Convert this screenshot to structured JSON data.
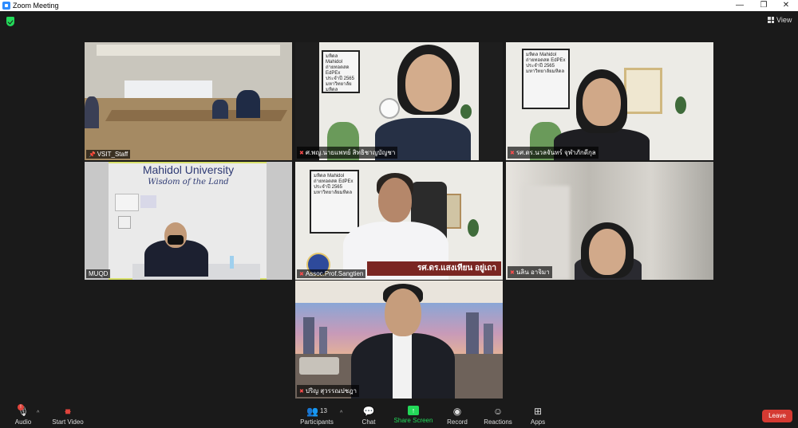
{
  "window": {
    "title": "Zoom Meeting",
    "controls": {
      "minimize": "—",
      "maximize": "❐",
      "close": "✕"
    }
  },
  "top": {
    "view_label": "View"
  },
  "participants": [
    {
      "name": "VSIT_Staff",
      "pinned": true
    },
    {
      "name": "ศ.พญ.นายแพทย์ สิทธิชาญบัญชา",
      "muted": true
    },
    {
      "name": "รศ.ดร.นวลจันทร์ จุฬาภักดีกุล",
      "muted": true
    },
    {
      "name": "MUQD",
      "active": true
    },
    {
      "name": "Assoc.Prof.Sangtien",
      "muted": true,
      "banner": "รศ.ดร.แสงเทียน อยู่เถา"
    },
    {
      "name": "นลิน อาจิมา",
      "muted": true
    },
    {
      "name": "ปริญ สุวรรณปชฎา",
      "muted": true
    }
  ],
  "scenes": {
    "mahidol_title": "Mahidol University",
    "mahidol_tagline": "Wisdom of the Land",
    "poster_lines": [
      "มหิดล Mahidol",
      "ถ่ายทอดสด EdPEx",
      "ประจำปี 2565",
      "มหาวิทยาลัยมหิดล"
    ]
  },
  "toolbar": {
    "audio": "Audio",
    "audio_badge": "!",
    "start_video": "Start Video",
    "participants": "Participants",
    "participants_count": "13",
    "chat": "Chat",
    "share_screen": "Share Screen",
    "record": "Record",
    "reactions": "Reactions",
    "apps": "Apps",
    "leave": "Leave"
  },
  "colors": {
    "active_speaker": "#d8e06a",
    "share": "#23d959",
    "leave": "#d53a32",
    "muted": "#ff4d4d"
  }
}
